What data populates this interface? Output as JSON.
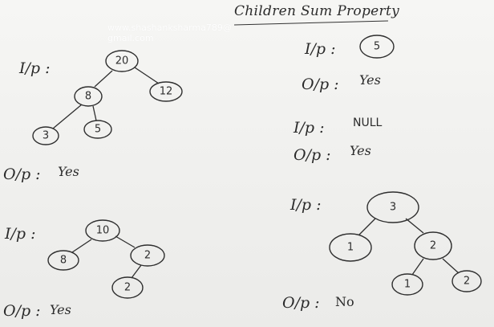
{
  "title": "Children Sum Property",
  "watermark": {
    "line1": "www.shashanksharma789@",
    "line2": "gmail.com"
  },
  "labels": {
    "input": "I/p :",
    "output": "O/p :"
  },
  "examples": [
    {
      "tree_values": [
        "20",
        "8",
        "12",
        "3",
        "5"
      ],
      "output": "Yes"
    },
    {
      "tree_values": [
        "10",
        "8",
        "2",
        "2"
      ],
      "output": "Yes"
    },
    {
      "input_text": "5",
      "output": "Yes"
    },
    {
      "input_text": "NULL",
      "output": "Yes"
    },
    {
      "tree_values": [
        "3",
        "1",
        "2",
        "1",
        "2"
      ],
      "output": "No"
    }
  ]
}
